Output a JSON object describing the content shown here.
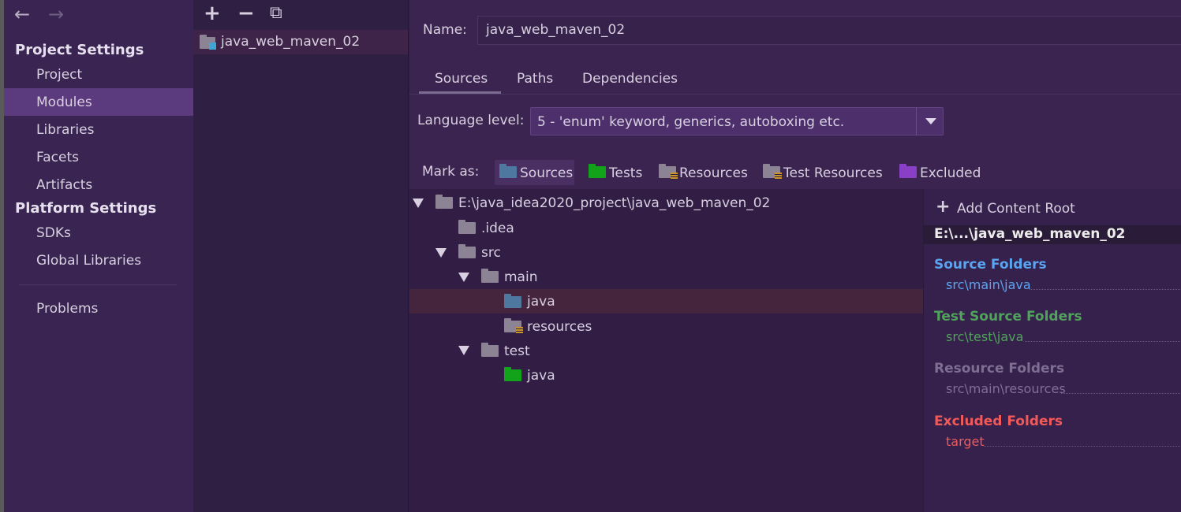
{
  "nav": {
    "back_icon": "←",
    "forward_icon": "→",
    "project_settings": "Project Settings",
    "platform_settings": "Platform Settings",
    "items": {
      "project": "Project",
      "modules": "Modules",
      "libraries": "Libraries",
      "facets": "Facets",
      "artifacts": "Artifacts",
      "sdks": "SDKs",
      "global_libraries": "Global Libraries",
      "problems": "Problems"
    }
  },
  "modules_panel": {
    "add_icon": "+",
    "remove_icon": "−",
    "copy_icon": "⧉",
    "module_name": "java_web_maven_02"
  },
  "main": {
    "name_label": "Name:",
    "name_value": "java_web_maven_02",
    "tabs": {
      "sources": "Sources",
      "paths": "Paths",
      "dependencies": "Dependencies"
    },
    "language_level_label": "Language level:",
    "language_level_value": "5 - 'enum' keyword, generics, autoboxing etc.",
    "mark_as_label": "Mark as:",
    "mark": {
      "sources": "Sources",
      "tests": "Tests",
      "resources": "Resources",
      "test_resources": "Test Resources",
      "excluded": "Excluded"
    }
  },
  "tree": {
    "root": "E:\\java_idea2020_project\\java_web_maven_02",
    "idea": ".idea",
    "src": "src",
    "main": "main",
    "java_main": "java",
    "resources": "resources",
    "test": "test",
    "java_test": "java"
  },
  "roots": {
    "add_content_root_icon": "+",
    "add_content_root": "Add Content Root",
    "root_title": "E:\\...\\java_web_maven_02",
    "source_folders": "Source Folders",
    "source_item": "src\\main\\java",
    "test_source_folders": "Test Source Folders",
    "test_source_item": "src\\test\\java",
    "resource_folders": "Resource Folders",
    "resource_item": "src\\main\\resources",
    "excluded_folders": "Excluded Folders",
    "excluded_item": "target"
  },
  "colors": {
    "source": "#5aa4f0",
    "test_source": "#4fa35a",
    "resource": "#7f6e92",
    "excluded": "#ef5a5a"
  }
}
